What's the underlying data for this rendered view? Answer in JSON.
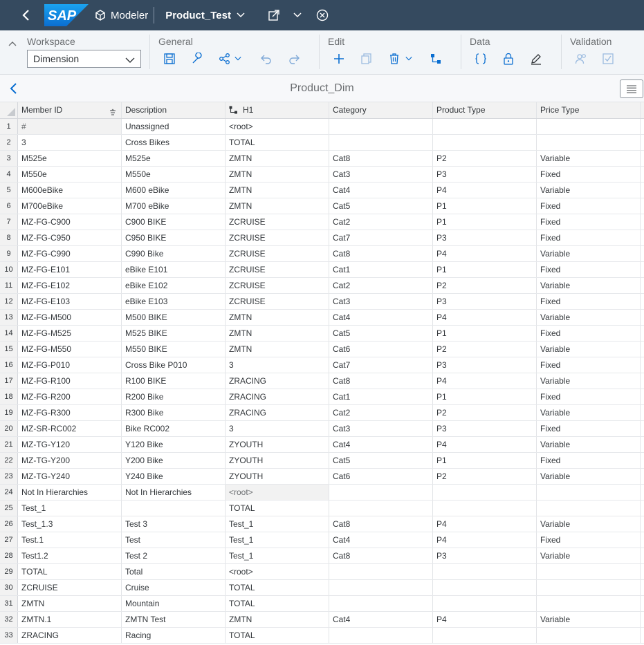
{
  "shell": {
    "logo_text": "SAP",
    "app_name": "Modeler",
    "doc_title": "Product_Test"
  },
  "toolbar": {
    "groups": {
      "workspace": "Workspace",
      "general": "General",
      "edit": "Edit",
      "data": "Data",
      "validation": "Validation"
    },
    "workspace_value": "Dimension"
  },
  "dimension": {
    "title": "Product_Dim"
  },
  "table": {
    "columns": [
      "Member ID",
      "Description",
      "H1",
      "Category",
      "Product Type",
      "Price Type"
    ],
    "rows": [
      {
        "n": "1",
        "id": "#",
        "desc": "Unassigned",
        "h1": "<root>",
        "cat": "",
        "pt": "",
        "price": ""
      },
      {
        "n": "2",
        "id": "3",
        "desc": "Cross Bikes",
        "h1": "TOTAL",
        "cat": "",
        "pt": "",
        "price": ""
      },
      {
        "n": "3",
        "id": "M525e",
        "desc": "M525e",
        "h1": "ZMTN",
        "cat": "Cat8",
        "pt": "P2",
        "price": "Variable"
      },
      {
        "n": "4",
        "id": "M550e",
        "desc": "M550e",
        "h1": "ZMTN",
        "cat": "Cat3",
        "pt": "P3",
        "price": "Fixed"
      },
      {
        "n": "5",
        "id": "M600eBike",
        "desc": "M600 eBike",
        "h1": "ZMTN",
        "cat": "Cat4",
        "pt": "P4",
        "price": "Variable"
      },
      {
        "n": "6",
        "id": "M700eBike",
        "desc": "M700 eBike",
        "h1": "ZMTN",
        "cat": "Cat5",
        "pt": "P1",
        "price": "Fixed"
      },
      {
        "n": "7",
        "id": "MZ-FG-C900",
        "desc": "C900 BIKE",
        "h1": "ZCRUISE",
        "cat": "Cat2",
        "pt": "P1",
        "price": "Fixed"
      },
      {
        "n": "8",
        "id": "MZ-FG-C950",
        "desc": "C950 BIKE",
        "h1": "ZCRUISE",
        "cat": "Cat7",
        "pt": "P3",
        "price": "Fixed"
      },
      {
        "n": "9",
        "id": "MZ-FG-C990",
        "desc": "C990 Bike",
        "h1": "ZCRUISE",
        "cat": "Cat8",
        "pt": "P4",
        "price": "Variable"
      },
      {
        "n": "10",
        "id": "MZ-FG-E101",
        "desc": "eBike E101",
        "h1": "ZCRUISE",
        "cat": "Cat1",
        "pt": "P1",
        "price": "Fixed"
      },
      {
        "n": "11",
        "id": "MZ-FG-E102",
        "desc": "eBike E102",
        "h1": "ZCRUISE",
        "cat": "Cat2",
        "pt": "P2",
        "price": "Variable"
      },
      {
        "n": "12",
        "id": "MZ-FG-E103",
        "desc": "eBike E103",
        "h1": "ZCRUISE",
        "cat": "Cat3",
        "pt": "P3",
        "price": "Fixed"
      },
      {
        "n": "13",
        "id": "MZ-FG-M500",
        "desc": "M500 BIKE",
        "h1": "ZMTN",
        "cat": "Cat4",
        "pt": "P4",
        "price": "Variable"
      },
      {
        "n": "14",
        "id": "MZ-FG-M525",
        "desc": "M525 BIKE",
        "h1": "ZMTN",
        "cat": "Cat5",
        "pt": "P1",
        "price": "Fixed"
      },
      {
        "n": "15",
        "id": "MZ-FG-M550",
        "desc": "M550 BIKE",
        "h1": "ZMTN",
        "cat": "Cat6",
        "pt": "P2",
        "price": "Variable"
      },
      {
        "n": "16",
        "id": "MZ-FG-P010",
        "desc": "Cross Bike P010",
        "h1": "3",
        "cat": "Cat7",
        "pt": "P3",
        "price": "Fixed"
      },
      {
        "n": "17",
        "id": "MZ-FG-R100",
        "desc": "R100 BIKE",
        "h1": "ZRACING",
        "cat": "Cat8",
        "pt": "P4",
        "price": "Variable"
      },
      {
        "n": "18",
        "id": "MZ-FG-R200",
        "desc": "R200 Bike",
        "h1": "ZRACING",
        "cat": "Cat1",
        "pt": "P1",
        "price": "Fixed"
      },
      {
        "n": "19",
        "id": "MZ-FG-R300",
        "desc": "R300 Bike",
        "h1": "ZRACING",
        "cat": "Cat2",
        "pt": "P2",
        "price": "Variable"
      },
      {
        "n": "20",
        "id": "MZ-SR-RC002",
        "desc": "Bike RC002",
        "h1": "3",
        "cat": "Cat3",
        "pt": "P3",
        "price": "Fixed"
      },
      {
        "n": "21",
        "id": "MZ-TG-Y120",
        "desc": "Y120 Bike",
        "h1": "ZYOUTH",
        "cat": "Cat4",
        "pt": "P4",
        "price": "Variable"
      },
      {
        "n": "22",
        "id": "MZ-TG-Y200",
        "desc": "Y200 Bike",
        "h1": "ZYOUTH",
        "cat": "Cat5",
        "pt": "P1",
        "price": "Fixed"
      },
      {
        "n": "23",
        "id": "MZ-TG-Y240",
        "desc": "Y240 Bike",
        "h1": "ZYOUTH",
        "cat": "Cat6",
        "pt": "P2",
        "price": "Variable"
      },
      {
        "n": "24",
        "id": "Not In Hierarchies",
        "desc": "Not In Hierarchies",
        "h1": "<root>",
        "cat": "",
        "pt": "",
        "price": ""
      },
      {
        "n": "25",
        "id": "Test_1",
        "desc": "",
        "h1": "TOTAL",
        "cat": "",
        "pt": "",
        "price": ""
      },
      {
        "n": "26",
        "id": "Test_1.3",
        "desc": "Test 3",
        "h1": "Test_1",
        "cat": "Cat8",
        "pt": "P4",
        "price": "Variable"
      },
      {
        "n": "27",
        "id": "Test.1",
        "desc": "Test",
        "h1": "Test_1",
        "cat": "Cat4",
        "pt": "P4",
        "price": "Fixed"
      },
      {
        "n": "28",
        "id": "Test1.2",
        "desc": "Test 2",
        "h1": "Test_1",
        "cat": "Cat8",
        "pt": "P3",
        "price": "Variable"
      },
      {
        "n": "29",
        "id": "TOTAL",
        "desc": "Total",
        "h1": "<root>",
        "cat": "",
        "pt": "",
        "price": ""
      },
      {
        "n": "30",
        "id": "ZCRUISE",
        "desc": "Cruise",
        "h1": "TOTAL",
        "cat": "",
        "pt": "",
        "price": ""
      },
      {
        "n": "31",
        "id": "ZMTN",
        "desc": "Mountain",
        "h1": "TOTAL",
        "cat": "",
        "pt": "",
        "price": ""
      },
      {
        "n": "32",
        "id": "ZMTN.1",
        "desc": "ZMTN Test",
        "h1": "ZMTN",
        "cat": "Cat4",
        "pt": "P4",
        "price": "Variable"
      },
      {
        "n": "33",
        "id": "ZRACING",
        "desc": "Racing",
        "h1": "TOTAL",
        "cat": "",
        "pt": "",
        "price": ""
      }
    ]
  },
  "colors": {
    "shell_bg": "#354a5f",
    "logo_blue": "#0a6ed1",
    "toolbar_bg": "#f2f5f8",
    "icon_color": "#0a6ed1"
  }
}
